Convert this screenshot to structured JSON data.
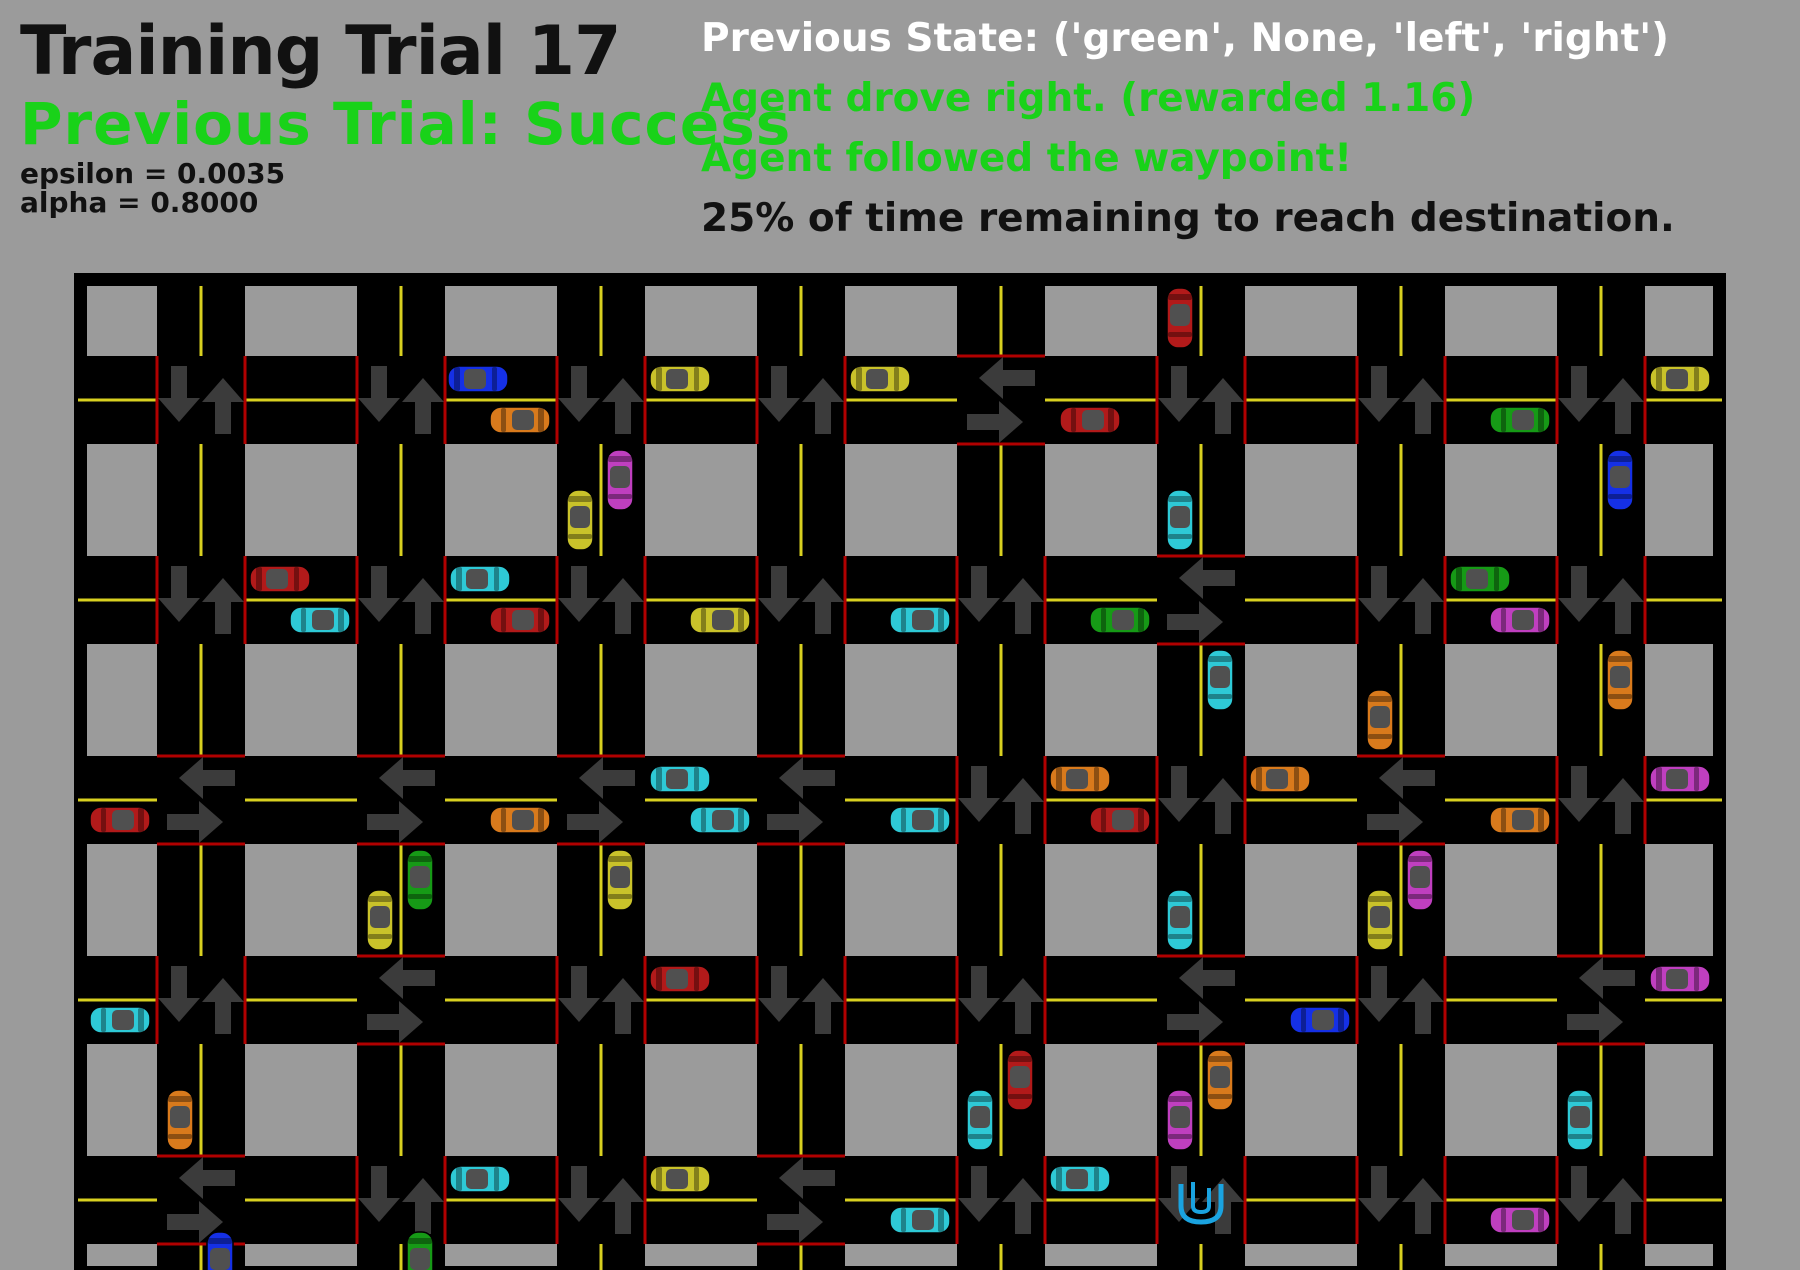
{
  "header": {
    "title": "Training Trial 17",
    "previous_trial": "Previous Trial: Success",
    "epsilon": "epsilon = 0.0035",
    "alpha": "alpha = 0.8000",
    "previous_state": "Previous State: ('green', None, 'left', 'right')",
    "action_result": "Agent drove right. (rewarded 1.16)",
    "waypoint_result": "Agent followed the waypoint!",
    "time_remaining": "25% of time remaining to reach destination."
  },
  "colors": {
    "background": "#9b9b9b",
    "road": "#000000",
    "lane_line": "#d8d020",
    "success_text": "#19d219",
    "agent_icon": "#1aa3e0"
  },
  "world": {
    "columns": 8,
    "rows": 6,
    "open_direction_by_row": [
      [
        "ns",
        "ns",
        "ns",
        "ns",
        "ew",
        "ns",
        "ns",
        "ns"
      ],
      [
        "ns",
        "ns",
        "ns",
        "ns",
        "ns",
        "ew",
        "ns",
        "ns"
      ],
      [
        "ew",
        "ew",
        "ew",
        "ew",
        "ns",
        "ns",
        "ew",
        "ns"
      ],
      [
        "ns",
        "ew",
        "ns",
        "ns",
        "ns",
        "ew",
        "ns",
        "ew"
      ],
      [
        "ew",
        "ns",
        "ns",
        "ew",
        "ns",
        "ns",
        "ns",
        "ns"
      ]
    ],
    "agent_icon": "udacity-logo-icon",
    "car_colors": [
      "blue",
      "cyan",
      "red",
      "orange",
      "yellow",
      "green",
      "magenta"
    ]
  }
}
